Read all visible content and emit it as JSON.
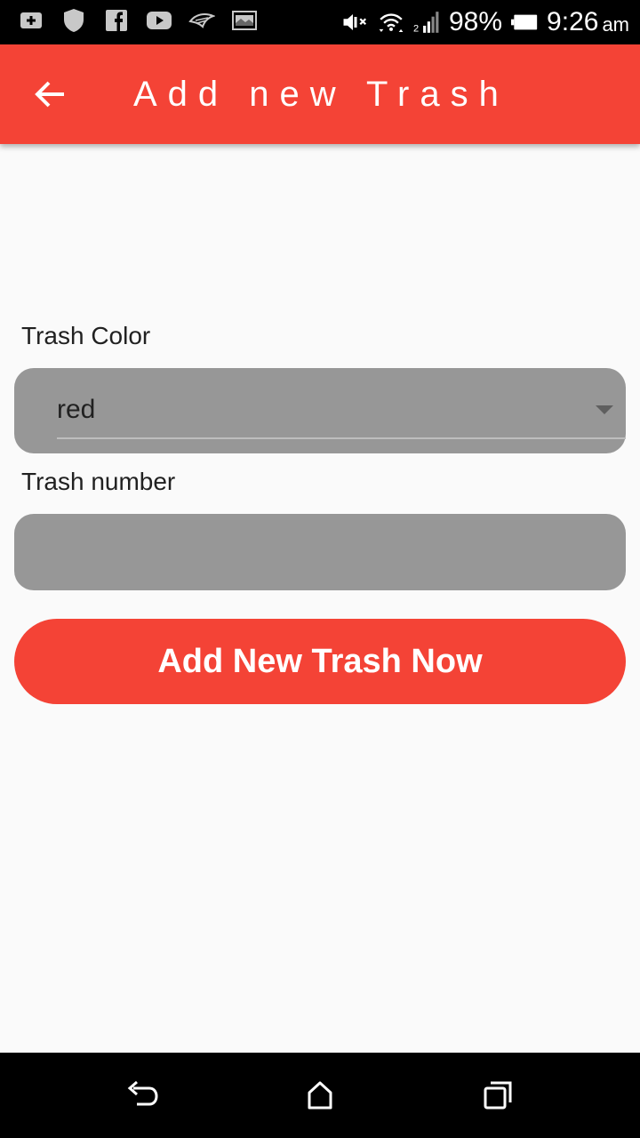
{
  "status_bar": {
    "battery": "98%",
    "time": "9:26",
    "ampm": "am",
    "icons_left": [
      "add-box-icon",
      "shield-icon",
      "facebook-icon",
      "youtube-icon",
      "bird-icon",
      "picture-icon"
    ],
    "icons_right": [
      "mute-icon",
      "wifi-icon",
      "signal-icon",
      "battery-icon"
    ]
  },
  "app_bar": {
    "title": "Add new Trash",
    "back_icon": "arrow-back-icon",
    "color": "#f44336"
  },
  "form": {
    "color_label": "Trash Color",
    "color_value": "red",
    "number_label": "Trash number",
    "number_value": "",
    "submit_label": "Add New Trash Now"
  },
  "nav_bar": {
    "icons": [
      "back-icon",
      "home-icon",
      "recents-icon"
    ]
  }
}
